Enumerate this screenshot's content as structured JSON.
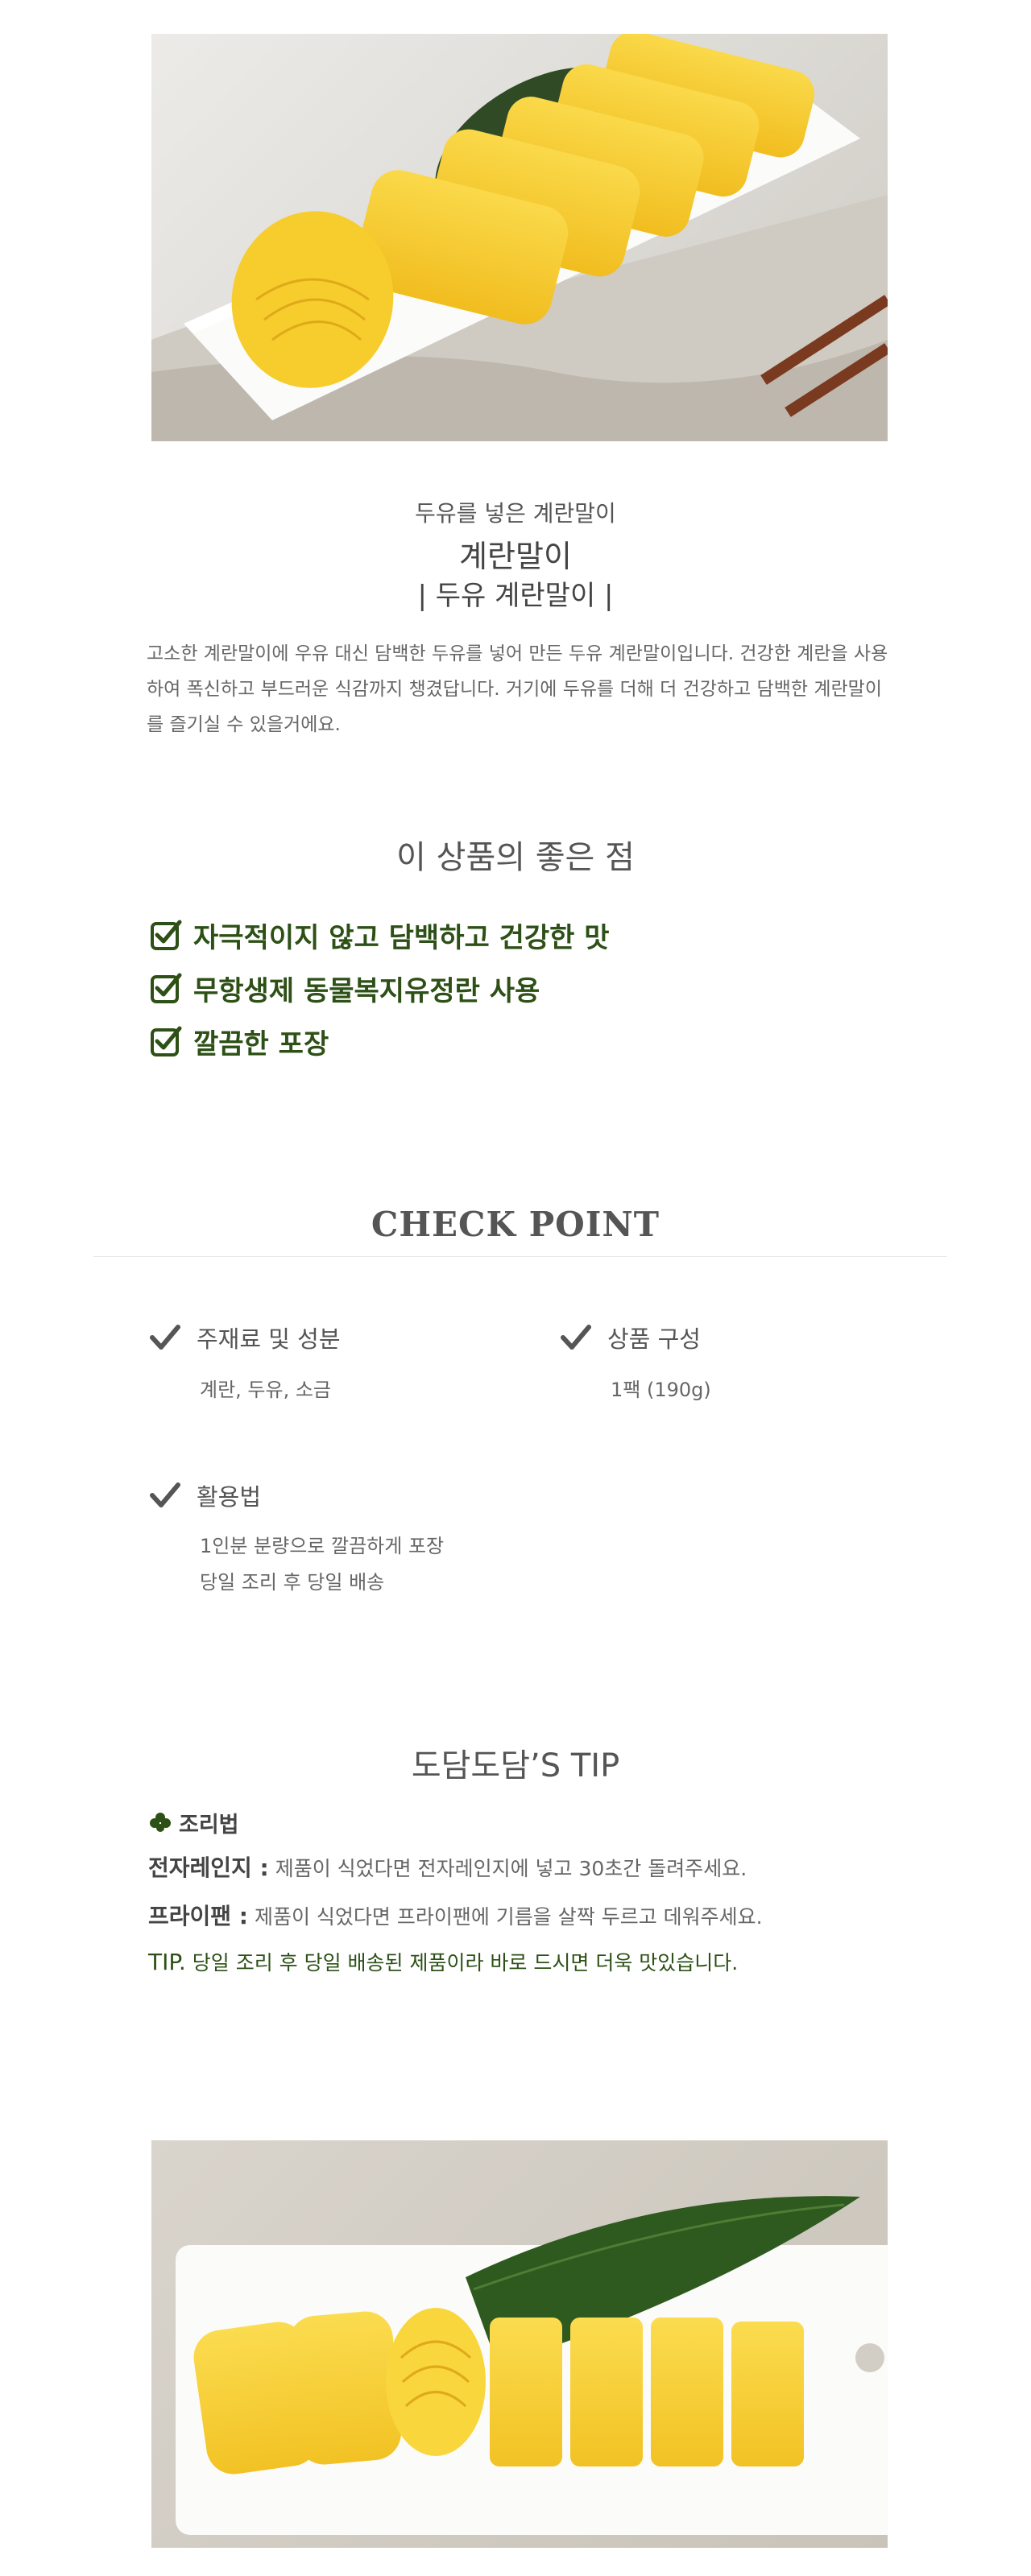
{
  "product": {
    "subtitle": "두유를 넣은 계란말이",
    "title": "계란말이",
    "title_bracket": "| 두유 계란말이 |",
    "description": "고소한 계란말이에 우유 대신 담백한 두유를 넣어 만든 두유 계란말이입니다. 건강한 계란을 사용하여 폭신하고 부드러운 식감까지 챙겼답니다. 거기에 두유를 더해 더 건강하고 담백한 계란말이를 즐기실 수 있을거에요."
  },
  "good_points": {
    "heading": "이 상품의 좋은 점",
    "items": [
      {
        "label": "자극적이지 않고 담백하고 건강한 맛"
      },
      {
        "label": "무항생제 동물복지유정란 사용"
      },
      {
        "label": "깔끔한 포장"
      }
    ]
  },
  "check_point": {
    "heading": "CHECK POINT",
    "ingredients_label": "주재료 및 성분",
    "ingredients_value": "계란, 두유, 소금",
    "composition_label": "상품 구성",
    "composition_value": "1팩 (190g)",
    "usage_label": "활용법",
    "usage_line1": "1인분 분량으로 깔끔하게 포장",
    "usage_line2": "당일 조리 후 당일 배송"
  },
  "tip": {
    "heading": "도담도담’S TIP",
    "howto_label": "조리법",
    "microwave_label": "전자레인지 :",
    "microwave_text": "제품이 식었다면 전자레인지에 넣고 30초간 돌려주세요.",
    "pan_label": "프라이팬 :",
    "pan_text": "제품이 식었다면 프라이팬에 기름을 살짝 두르고 데워주세요.",
    "tip_label": "TIP.",
    "tip_text": "당일 조리 후 당일 배송된 제품이라 바로 드시면 더욱 맛있습니다."
  },
  "colors": {
    "accent_green": "#2d5016",
    "text_gray": "#555555",
    "egg_yellow": "#f5c830"
  }
}
